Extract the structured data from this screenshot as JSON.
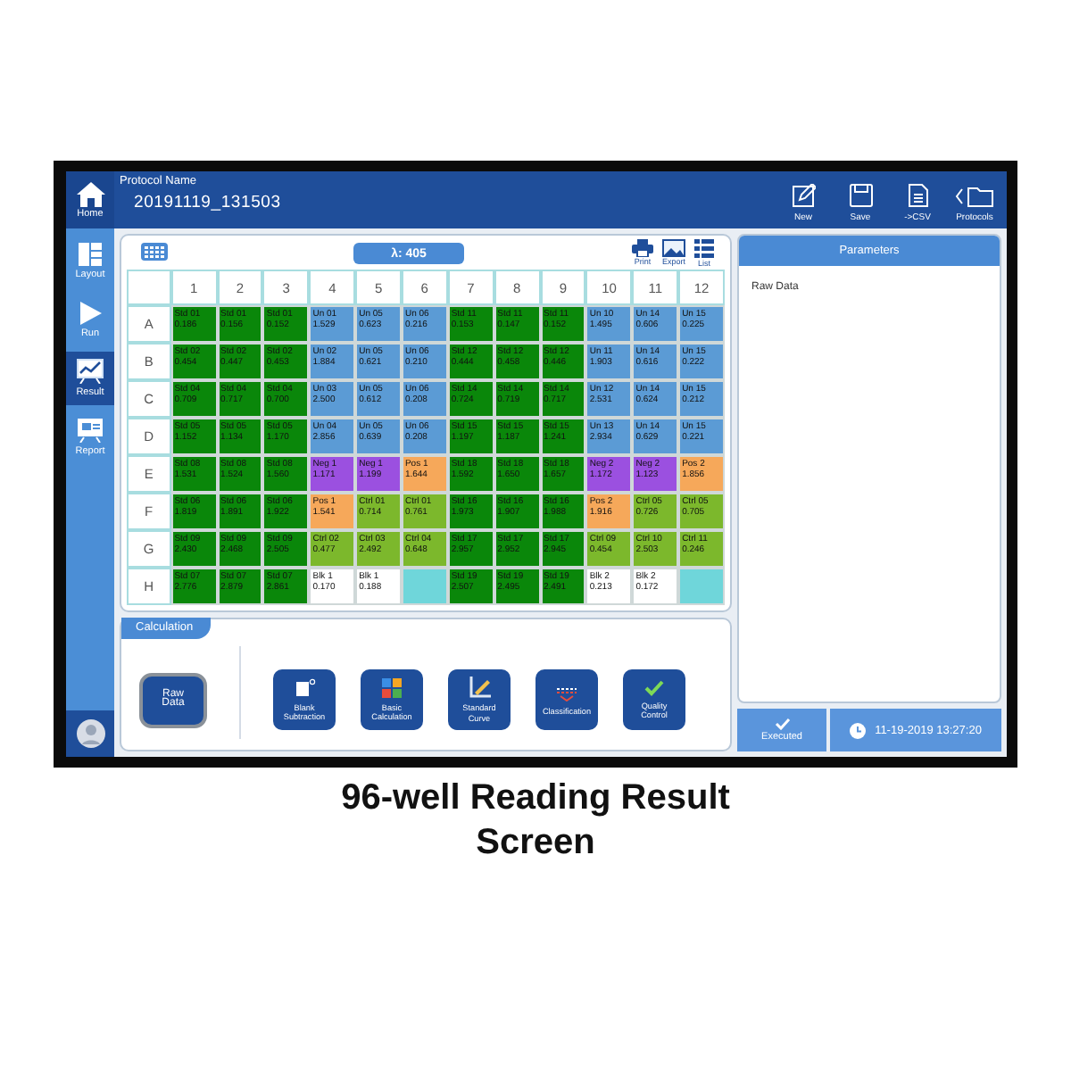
{
  "header": {
    "label": "Protocol Name",
    "protocol": "20191119_131503",
    "actions": [
      {
        "label": "New"
      },
      {
        "label": "Save"
      },
      {
        "label": "->CSV"
      },
      {
        "label": "Protocols"
      }
    ]
  },
  "sidebar": {
    "home": "Home",
    "items": [
      {
        "label": "Layout",
        "selected": false
      },
      {
        "label": "Run",
        "selected": false
      },
      {
        "label": "Result",
        "selected": true
      },
      {
        "label": "Report",
        "selected": false
      }
    ]
  },
  "plate": {
    "wavelength": "λ: 405",
    "tools": [
      {
        "label": "Print"
      },
      {
        "label": "Export"
      },
      {
        "label": "List"
      }
    ],
    "columns": [
      "1",
      "2",
      "3",
      "4",
      "5",
      "6",
      "7",
      "8",
      "9",
      "10",
      "11",
      "12"
    ],
    "rows": [
      {
        "label": "A",
        "cells": [
          {
            "name": "Std 01",
            "value": "0.186",
            "color": "#0a870a"
          },
          {
            "name": "Std 01",
            "value": "0.156",
            "color": "#0a870a"
          },
          {
            "name": "Std 01",
            "value": "0.152",
            "color": "#0a870a"
          },
          {
            "name": "Un 01",
            "value": "1.529",
            "color": "#5b9bd5"
          },
          {
            "name": "Un 05",
            "value": "0.623",
            "color": "#5b9bd5"
          },
          {
            "name": "Un 06",
            "value": "0.216",
            "color": "#5b9bd5"
          },
          {
            "name": "Std 11",
            "value": "0.153",
            "color": "#0a870a"
          },
          {
            "name": "Std 11",
            "value": "0.147",
            "color": "#0a870a"
          },
          {
            "name": "Std 11",
            "value": "0.152",
            "color": "#0a870a"
          },
          {
            "name": "Un 10",
            "value": "1.495",
            "color": "#5b9bd5"
          },
          {
            "name": "Un 14",
            "value": "0.606",
            "color": "#5b9bd5"
          },
          {
            "name": "Un 15",
            "value": "0.225",
            "color": "#5b9bd5"
          }
        ]
      },
      {
        "label": "B",
        "cells": [
          {
            "name": "Std 02",
            "value": "0.454",
            "color": "#0a870a"
          },
          {
            "name": "Std 02",
            "value": "0.447",
            "color": "#0a870a"
          },
          {
            "name": "Std 02",
            "value": "0.453",
            "color": "#0a870a"
          },
          {
            "name": "Un 02",
            "value": "1.884",
            "color": "#5b9bd5"
          },
          {
            "name": "Un 05",
            "value": "0.621",
            "color": "#5b9bd5"
          },
          {
            "name": "Un 06",
            "value": "0.210",
            "color": "#5b9bd5"
          },
          {
            "name": "Std 12",
            "value": "0.444",
            "color": "#0a870a"
          },
          {
            "name": "Std 12",
            "value": "0.458",
            "color": "#0a870a"
          },
          {
            "name": "Std 12",
            "value": "0.446",
            "color": "#0a870a"
          },
          {
            "name": "Un 11",
            "value": "1.903",
            "color": "#5b9bd5"
          },
          {
            "name": "Un 14",
            "value": "0.616",
            "color": "#5b9bd5"
          },
          {
            "name": "Un 15",
            "value": "0.222",
            "color": "#5b9bd5"
          }
        ]
      },
      {
        "label": "C",
        "cells": [
          {
            "name": "Std 04",
            "value": "0.709",
            "color": "#0a870a"
          },
          {
            "name": "Std 04",
            "value": "0.717",
            "color": "#0a870a"
          },
          {
            "name": "Std 04",
            "value": "0.700",
            "color": "#0a870a"
          },
          {
            "name": "Un 03",
            "value": "2.500",
            "color": "#5b9bd5"
          },
          {
            "name": "Un 05",
            "value": "0.612",
            "color": "#5b9bd5"
          },
          {
            "name": "Un 06",
            "value": "0.208",
            "color": "#5b9bd5"
          },
          {
            "name": "Std 14",
            "value": "0.724",
            "color": "#0a870a"
          },
          {
            "name": "Std 14",
            "value": "0.719",
            "color": "#0a870a"
          },
          {
            "name": "Std 14",
            "value": "0.717",
            "color": "#0a870a"
          },
          {
            "name": "Un 12",
            "value": "2.531",
            "color": "#5b9bd5"
          },
          {
            "name": "Un 14",
            "value": "0.624",
            "color": "#5b9bd5"
          },
          {
            "name": "Un 15",
            "value": "0.212",
            "color": "#5b9bd5"
          }
        ]
      },
      {
        "label": "D",
        "cells": [
          {
            "name": "Std 05",
            "value": "1.152",
            "color": "#0a870a"
          },
          {
            "name": "Std 05",
            "value": "1.134",
            "color": "#0a870a"
          },
          {
            "name": "Std 05",
            "value": "1.170",
            "color": "#0a870a"
          },
          {
            "name": "Un 04",
            "value": "2.856",
            "color": "#5b9bd5"
          },
          {
            "name": "Un 05",
            "value": "0.639",
            "color": "#5b9bd5"
          },
          {
            "name": "Un 06",
            "value": "0.208",
            "color": "#5b9bd5"
          },
          {
            "name": "Std 15",
            "value": "1.197",
            "color": "#0a870a"
          },
          {
            "name": "Std 15",
            "value": "1.187",
            "color": "#0a870a"
          },
          {
            "name": "Std 15",
            "value": "1.241",
            "color": "#0a870a"
          },
          {
            "name": "Un 13",
            "value": "2.934",
            "color": "#5b9bd5"
          },
          {
            "name": "Un 14",
            "value": "0.629",
            "color": "#5b9bd5"
          },
          {
            "name": "Un 15",
            "value": "0.221",
            "color": "#5b9bd5"
          }
        ]
      },
      {
        "label": "E",
        "cells": [
          {
            "name": "Std 08",
            "value": "1.531",
            "color": "#0a870a"
          },
          {
            "name": "Std 08",
            "value": "1.524",
            "color": "#0a870a"
          },
          {
            "name": "Std 08",
            "value": "1.560",
            "color": "#0a870a"
          },
          {
            "name": "Neg 1",
            "value": "1.171",
            "color": "#9b50e0"
          },
          {
            "name": "Neg 1",
            "value": "1.199",
            "color": "#9b50e0"
          },
          {
            "name": "Pos 1",
            "value": "1.644",
            "color": "#f6a85a"
          },
          {
            "name": "Std 18",
            "value": "1.592",
            "color": "#0a870a"
          },
          {
            "name": "Std 18",
            "value": "1.650",
            "color": "#0a870a"
          },
          {
            "name": "Std 18",
            "value": "1.657",
            "color": "#0a870a"
          },
          {
            "name": "Neg 2",
            "value": "1.172",
            "color": "#9b50e0"
          },
          {
            "name": "Neg 2",
            "value": "1.123",
            "color": "#9b50e0"
          },
          {
            "name": "Pos 2",
            "value": "1.856",
            "color": "#f6a85a"
          }
        ]
      },
      {
        "label": "F",
        "cells": [
          {
            "name": "Std 06",
            "value": "1.819",
            "color": "#0a870a"
          },
          {
            "name": "Std 06",
            "value": "1.891",
            "color": "#0a870a"
          },
          {
            "name": "Std 06",
            "value": "1.922",
            "color": "#0a870a"
          },
          {
            "name": "Pos 1",
            "value": "1.541",
            "color": "#f6a85a"
          },
          {
            "name": "Ctrl 01",
            "value": "0.714",
            "color": "#7cb82c"
          },
          {
            "name": "Ctrl 01",
            "value": "0.761",
            "color": "#7cb82c"
          },
          {
            "name": "Std 16",
            "value": "1.973",
            "color": "#0a870a"
          },
          {
            "name": "Std 16",
            "value": "1.907",
            "color": "#0a870a"
          },
          {
            "name": "Std 16",
            "value": "1.988",
            "color": "#0a870a"
          },
          {
            "name": "Pos 2",
            "value": "1.916",
            "color": "#f6a85a"
          },
          {
            "name": "Ctrl 05",
            "value": "0.726",
            "color": "#7cb82c"
          },
          {
            "name": "Ctrl 05",
            "value": "0.705",
            "color": "#7cb82c"
          }
        ]
      },
      {
        "label": "G",
        "cells": [
          {
            "name": "Std 09",
            "value": "2.430",
            "color": "#0a870a"
          },
          {
            "name": "Std 09",
            "value": "2.468",
            "color": "#0a870a"
          },
          {
            "name": "Std 09",
            "value": "2.505",
            "color": "#0a870a"
          },
          {
            "name": "Ctrl 02",
            "value": "0.477",
            "color": "#7cb82c"
          },
          {
            "name": "Ctrl 03",
            "value": "2.492",
            "color": "#7cb82c"
          },
          {
            "name": "Ctrl 04",
            "value": "0.648",
            "color": "#7cb82c"
          },
          {
            "name": "Std 17",
            "value": "2.957",
            "color": "#0a870a"
          },
          {
            "name": "Std 17",
            "value": "2.952",
            "color": "#0a870a"
          },
          {
            "name": "Std 17",
            "value": "2.945",
            "color": "#0a870a"
          },
          {
            "name": "Ctrl 09",
            "value": "0.454",
            "color": "#7cb82c"
          },
          {
            "name": "Ctrl 10",
            "value": "2.503",
            "color": "#7cb82c"
          },
          {
            "name": "Ctrl 11",
            "value": "0.246",
            "color": "#7cb82c"
          }
        ]
      },
      {
        "label": "H",
        "cells": [
          {
            "name": "Std 07",
            "value": "2.776",
            "color": "#0a870a"
          },
          {
            "name": "Std 07",
            "value": "2.879",
            "color": "#0a870a"
          },
          {
            "name": "Std 07",
            "value": "2.861",
            "color": "#0a870a"
          },
          {
            "name": "Blk 1",
            "value": "0.170",
            "color": "#ffffff"
          },
          {
            "name": "Blk 1",
            "value": "0.188",
            "color": "#ffffff"
          },
          {
            "color": "#6fd6da"
          },
          {
            "name": "Std 19",
            "value": "2.507",
            "color": "#0a870a"
          },
          {
            "name": "Std 19",
            "value": "2.495",
            "color": "#0a870a"
          },
          {
            "name": "Std 19",
            "value": "2.491",
            "color": "#0a870a"
          },
          {
            "name": "Blk 2",
            "value": "0.213",
            "color": "#ffffff"
          },
          {
            "name": "Blk 2",
            "value": "0.172",
            "color": "#ffffff"
          },
          {
            "color": "#6fd6da"
          }
        ]
      }
    ]
  },
  "calculation": {
    "title": "Calculation",
    "steps": [
      {
        "label": "Raw Data",
        "selected": true
      },
      {
        "label": "Blank Subtraction",
        "selected": false
      },
      {
        "label": "Basic Calculation",
        "selected": false
      },
      {
        "label": "Standard Curve",
        "selected": false
      },
      {
        "label": "Classification",
        "selected": false
      },
      {
        "label": "Quality Control",
        "selected": false
      }
    ]
  },
  "parameters": {
    "title": "Parameters",
    "text": "Raw Data"
  },
  "status": {
    "state": "Executed",
    "timestamp": "11-19-2019 13:27:20"
  },
  "caption": "96-well Reading Result Screen"
}
